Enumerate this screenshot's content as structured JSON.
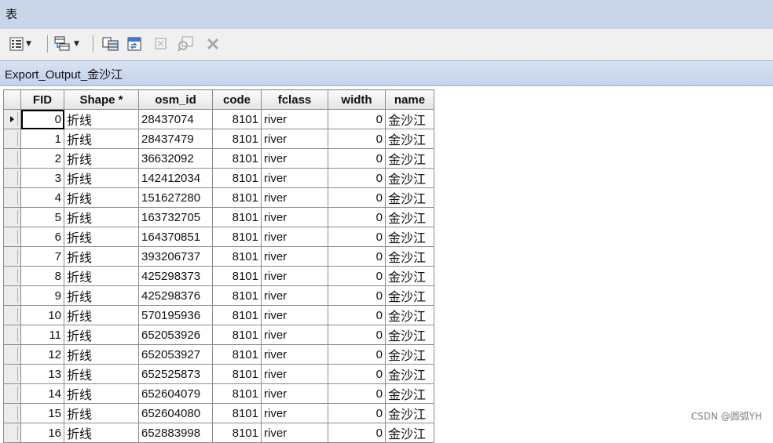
{
  "window": {
    "title": "表"
  },
  "toolbar": {
    "icons": [
      "table-options-icon",
      "related-tables-icon",
      "select-by-attributes-icon",
      "switch-selection-icon",
      "clear-selection-icon",
      "zoom-to-selected-icon",
      "delete-selected-icon"
    ]
  },
  "tab": {
    "name": "Export_Output_金沙江"
  },
  "table": {
    "columns": [
      "FID",
      "Shape *",
      "osm_id",
      "code",
      "fclass",
      "width",
      "name"
    ],
    "rows": [
      [
        "0",
        "折线",
        "28437074",
        "8101",
        "river",
        "0",
        "金沙江"
      ],
      [
        "1",
        "折线",
        "28437479",
        "8101",
        "river",
        "0",
        "金沙江"
      ],
      [
        "2",
        "折线",
        "36632092",
        "8101",
        "river",
        "0",
        "金沙江"
      ],
      [
        "3",
        "折线",
        "142412034",
        "8101",
        "river",
        "0",
        "金沙江"
      ],
      [
        "4",
        "折线",
        "151627280",
        "8101",
        "river",
        "0",
        "金沙江"
      ],
      [
        "5",
        "折线",
        "163732705",
        "8101",
        "river",
        "0",
        "金沙江"
      ],
      [
        "6",
        "折线",
        "164370851",
        "8101",
        "river",
        "0",
        "金沙江"
      ],
      [
        "7",
        "折线",
        "393206737",
        "8101",
        "river",
        "0",
        "金沙江"
      ],
      [
        "8",
        "折线",
        "425298373",
        "8101",
        "river",
        "0",
        "金沙江"
      ],
      [
        "9",
        "折线",
        "425298376",
        "8101",
        "river",
        "0",
        "金沙江"
      ],
      [
        "10",
        "折线",
        "570195936",
        "8101",
        "river",
        "0",
        "金沙江"
      ],
      [
        "11",
        "折线",
        "652053926",
        "8101",
        "river",
        "0",
        "金沙江"
      ],
      [
        "12",
        "折线",
        "652053927",
        "8101",
        "river",
        "0",
        "金沙江"
      ],
      [
        "13",
        "折线",
        "652525873",
        "8101",
        "river",
        "0",
        "金沙江"
      ],
      [
        "14",
        "折线",
        "652604079",
        "8101",
        "river",
        "0",
        "金沙江"
      ],
      [
        "15",
        "折线",
        "652604080",
        "8101",
        "river",
        "0",
        "金沙江"
      ],
      [
        "16",
        "折线",
        "652883998",
        "8101",
        "river",
        "0",
        "金沙江"
      ]
    ],
    "current_row": 0
  },
  "watermark": "CSDN @圆弧YH",
  "colors": {
    "titlebar": "#c9d6ea",
    "tabbar": "#c3d3ea",
    "toolbar": "#f0f0f0",
    "grid_border": "#8c8c8c"
  }
}
